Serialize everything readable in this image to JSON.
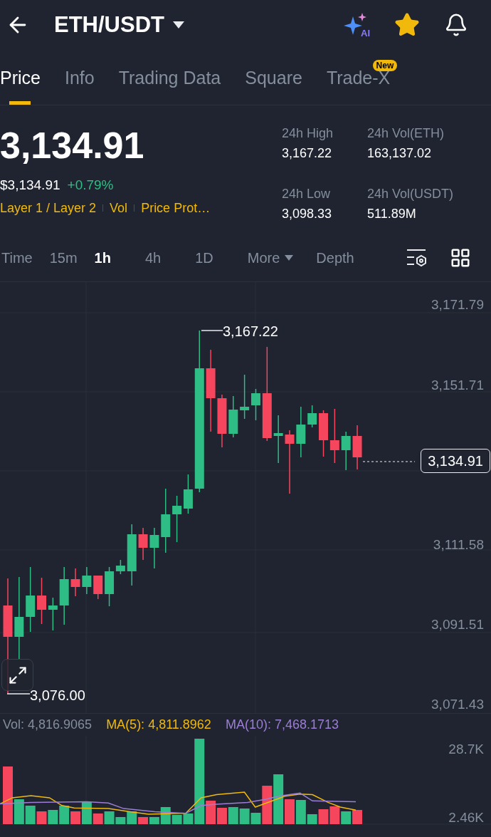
{
  "header": {
    "pair": "ETH/USDT",
    "ai_label": "AI",
    "favorite": true
  },
  "tabs": [
    {
      "label": "Price",
      "selected": true
    },
    {
      "label": "Info",
      "selected": false
    },
    {
      "label": "Trading Data",
      "selected": false
    },
    {
      "label": "Square",
      "selected": false
    },
    {
      "label": "Trade-X",
      "selected": false,
      "badge": "New"
    }
  ],
  "price": {
    "last": "3,134.91",
    "usd": "$3,134.91",
    "change": "+0.79%",
    "tags": [
      "Layer 1 / Layer 2",
      "Vol",
      "Price Prot…"
    ]
  },
  "stats": [
    {
      "label": "24h High",
      "value": "3,167.22"
    },
    {
      "label": "24h Vol(ETH)",
      "value": "163,137.02"
    },
    {
      "label": "24h Low",
      "value": "3,098.33"
    },
    {
      "label": "24h Vol(USDT)",
      "value": "511.89M"
    }
  ],
  "intervals": [
    {
      "label": "Time",
      "selected": false
    },
    {
      "label": "15m",
      "selected": false
    },
    {
      "label": "1h",
      "selected": true
    },
    {
      "label": "4h",
      "selected": false
    },
    {
      "label": "1D",
      "selected": false
    },
    {
      "label": "More",
      "selected": false,
      "dropdown": true
    },
    {
      "label": "Depth",
      "selected": false
    }
  ],
  "chart": {
    "price_ticks": [
      "3,171.79",
      "3,151.71",
      "3,111.58",
      "3,091.51",
      "3,071.43"
    ],
    "high_label": "3,167.22",
    "low_label": "3,076.00",
    "last_price": "3,134.91"
  },
  "volume": {
    "vol": "Vol: 4,816.9065",
    "ma5": "MA(5): 4,811.8962",
    "ma10": "MA(10): 7,468.1713",
    "ticks": [
      "28.7K",
      "2.46K"
    ]
  }
}
